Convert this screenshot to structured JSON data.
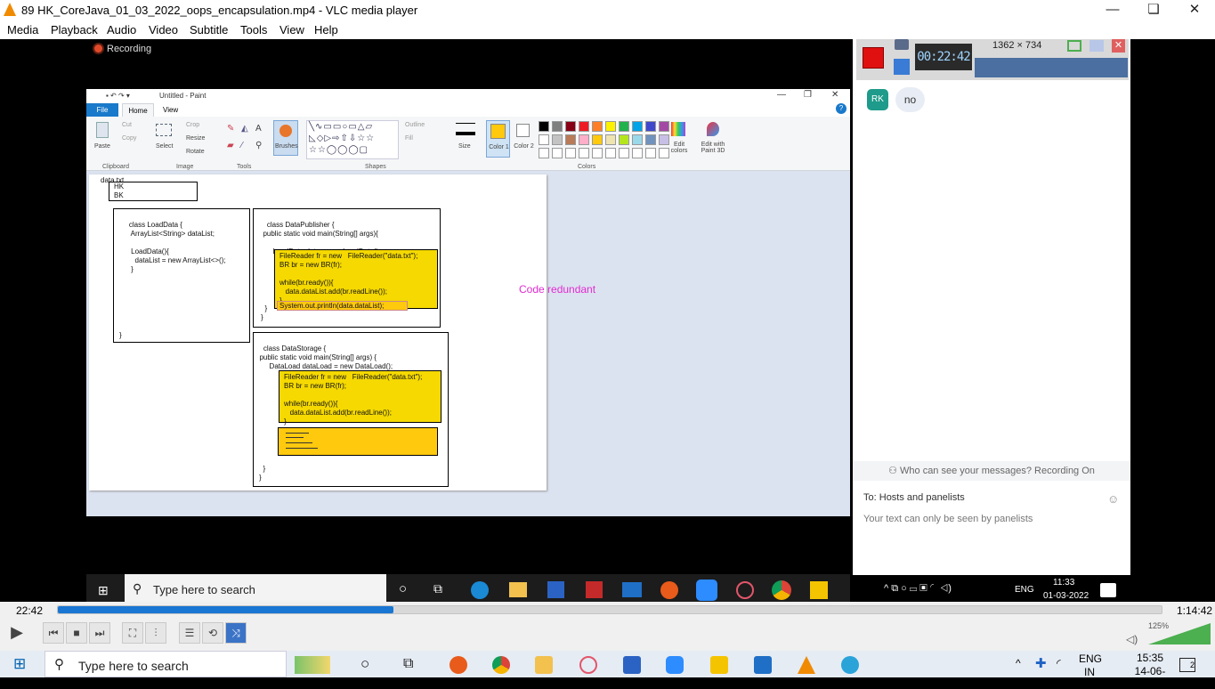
{
  "window": {
    "title": "89 HK_CoreJava_01_03_2022_oops_encapsulation.mp4 - VLC media player"
  },
  "menu": [
    "Media",
    "Playback",
    "Audio",
    "Video",
    "Subtitle",
    "Tools",
    "View",
    "Help"
  ],
  "video_left": {
    "recording_label": "Recording",
    "paint": {
      "title": "Untitled - Paint",
      "tabs": [
        "File",
        "Home",
        "View"
      ],
      "groups": [
        "Clipboard",
        "Image",
        "Tools",
        "Shapes",
        "Colors"
      ],
      "clipboard": {
        "paste": "Paste",
        "cut": "Cut",
        "copy": "Copy"
      },
      "image": {
        "select": "Select",
        "crop": "Crop",
        "resize": "Resize",
        "rotate": "Rotate"
      },
      "brushes": "Brushes",
      "outline": "Outline",
      "fill": "Fill",
      "size": "Size",
      "color1": "Color 1",
      "color2": "Color 2",
      "edit_colors": "Edit colors",
      "edit_paint3d": "Edit with Paint 3D",
      "palette": [
        "#000000",
        "#7f7f7f",
        "#880015",
        "#ed1c24",
        "#ff7f27",
        "#fff200",
        "#22b14c",
        "#00a2e8",
        "#3f48cc",
        "#a349a4",
        "#ffffff",
        "#c3c3c3",
        "#b97a57",
        "#ffaec9",
        "#ffc90e",
        "#efe4b0",
        "#b5e61d",
        "#99d9ea",
        "#7092be",
        "#c8bfe7"
      ]
    },
    "canvas": {
      "data_file_label": "data.txt",
      "data_file_lines": "HK\nBK",
      "load_data": "class LoadData {\n     ArrayList<String> dataList;\n\n     LoadData(){\n       dataList = new ArrayList<>();\n     }",
      "load_data_close": "}",
      "publisher_head": "class DataPublisher {\n  public static void main(String[] args){\n\n       LoadData data = new LoadData();",
      "publisher_yellow": "FileReader fr = new   FileReader(\"data.txt\");\nBR br = new BR(fr);\n\nwhile(br.ready()){\n   data.dataList.add(br.readLine());\n}",
      "publisher_print": "System.out.println(data.dataList);",
      "publisher_close": "  }\n}",
      "storage_head": "class DataStorage {\n  public static void main(String[] args) {\n       DataLoad dataLoad = new DataLoad();",
      "storage_yellow": "FileReader fr = new   FileReader(\"data.txt\");\nBR br = new BR(fr);\n\nwhile(br.ready()){\n   data.dataList.add(br.readLine());\n}",
      "storage_close": "  }\n}",
      "annotation": "Code redundant"
    },
    "inner_taskbar": {
      "search_placeholder": "Type here to search",
      "time": "11:33",
      "date": "01-03-2022",
      "lang": "ENG"
    }
  },
  "video_right": {
    "recorder_resolution": "1362 × 734",
    "recorder_timer": "00:22:42",
    "sender_initials": "RK",
    "message": "no",
    "visibility_note": "Who can see your messages? Recording On",
    "to_label": "To:",
    "to_value": "Hosts and panelists",
    "input_placeholder": "Your text can only be seen by panelists"
  },
  "player": {
    "elapsed": "22:42",
    "total": "1:14:42",
    "progress": 0.304,
    "volume_label": "125%"
  },
  "taskbar": {
    "search_placeholder": "Type here to search",
    "lang": "ENG",
    "lang_sub": "IN",
    "time": "15:35",
    "date": "14-06-2022",
    "notification_count": "2"
  }
}
